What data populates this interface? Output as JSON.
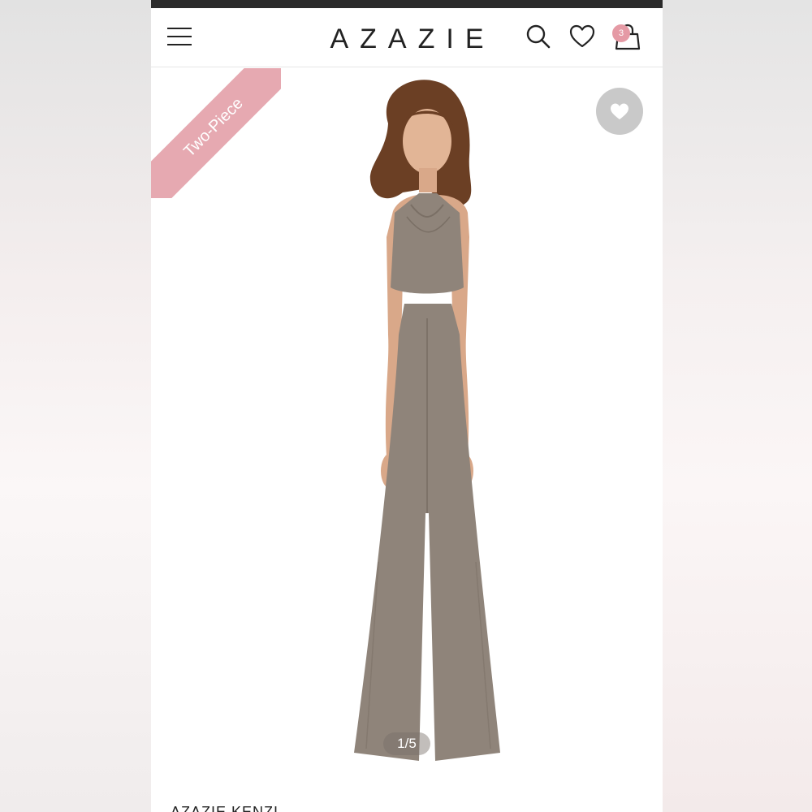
{
  "header": {
    "logo": "AZAZIE",
    "cart_count": "3",
    "icons": [
      "menu-icon",
      "search-icon",
      "heart-icon",
      "shopping-bag-icon"
    ]
  },
  "gallery": {
    "badge": "Two-Piece",
    "counter": "1/5"
  },
  "product": {
    "name": "AZAZIE KENZI"
  },
  "colors": {
    "badge_pink": "#e6a9b1",
    "cart_badge": "#e59aa5",
    "garment_taupe": "#8f847a",
    "text_dark": "#222222"
  }
}
